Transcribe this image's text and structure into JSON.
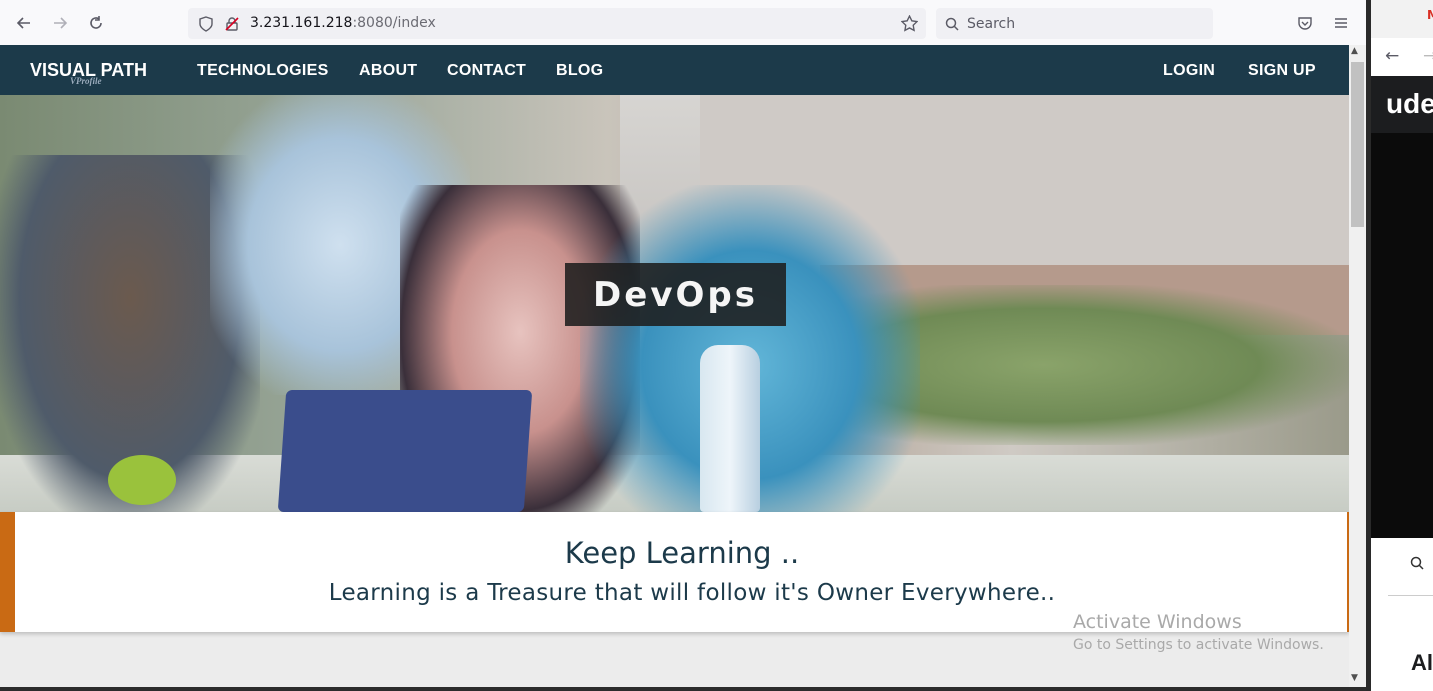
{
  "browser": {
    "url_host": "3.231.161.218",
    "url_rest": ":8080/index",
    "search_placeholder": "Search"
  },
  "navbar": {
    "brand": "VISUAL PATH",
    "brand_sub": "VProfile",
    "links": [
      "TECHNOLOGIES",
      "ABOUT",
      "CONTACT",
      "BLOG"
    ],
    "login": "LOGIN",
    "signup": "SIGN UP"
  },
  "hero": {
    "caption": "DevOps"
  },
  "card": {
    "title": "Keep Learning ..",
    "subtitle": "Learning is a Treasure that will follow it's Owner Everywhere.."
  },
  "watermark": {
    "line1": "Activate Windows",
    "line2": "Go to Settings to activate Windows."
  },
  "right_window": {
    "logo": "ude",
    "heading": "Al",
    "tab_icon": "M"
  },
  "colors": {
    "navbar": "#1c3a4a",
    "accent": "#c96a14"
  }
}
